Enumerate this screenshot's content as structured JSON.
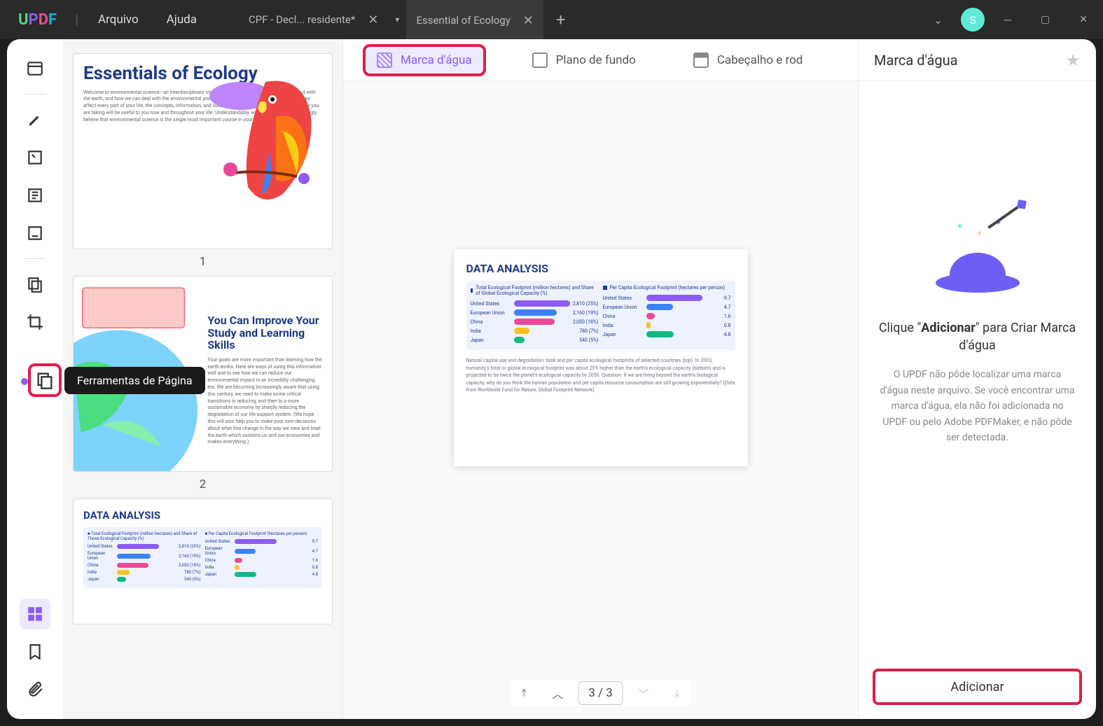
{
  "titlebar": {
    "menus": {
      "file": "Arquivo",
      "help": "Ajuda"
    },
    "tabs": [
      {
        "label": "CPF - Decl... residente*",
        "active": false
      },
      {
        "label": "Essential of Ecology",
        "active": true
      }
    ],
    "avatar_initial": "S"
  },
  "left_rail": {
    "tooltip": "Ferramentas de Página"
  },
  "thumbnails": [
    {
      "num": "1",
      "title": "Essentials of Ecology"
    },
    {
      "num": "2",
      "title": "You Can Improve Your Study and Learning Skills"
    },
    {
      "num": "3",
      "title": "DATA ANALYSIS"
    }
  ],
  "top_tabs": {
    "watermark": "Marca d'água",
    "background": "Plano de fundo",
    "header_footer": "Cabeçalho e rod"
  },
  "pager": {
    "display": "3  /  3"
  },
  "chart_data": {
    "type": "bar",
    "title": "DATA ANALYSIS",
    "left_panel": {
      "header": "Total Ecological Footprint (million hectares) and Share of Global Ecological Capacity (%)",
      "rows": [
        {
          "label": "United States",
          "value_label": "2,810 (25%)",
          "pct": 100,
          "color": "c-purple"
        },
        {
          "label": "European Union",
          "value_label": "2,160 (19%)",
          "pct": 77,
          "color": "c-blue"
        },
        {
          "label": "China",
          "value_label": "2,050 (18%)",
          "pct": 73,
          "color": "c-pink"
        },
        {
          "label": "India",
          "value_label": "780 (7%)",
          "pct": 28,
          "color": "c-yellow"
        },
        {
          "label": "Japan",
          "value_label": "540 (5%)",
          "pct": 19,
          "color": "c-green"
        }
      ]
    },
    "right_panel": {
      "header": "Per Capita Ecological Footprint (hectares per person)",
      "rows": [
        {
          "label": "United States",
          "value_label": "9.7",
          "pct": 100,
          "color": "c-purple"
        },
        {
          "label": "European Union",
          "value_label": "4.7",
          "pct": 48,
          "color": "c-blue"
        },
        {
          "label": "China",
          "value_label": "1.6",
          "pct": 16,
          "color": "c-pink"
        },
        {
          "label": "India",
          "value_label": "0.8",
          "pct": 8,
          "color": "c-yellow"
        },
        {
          "label": "Japan",
          "value_label": "4.8",
          "pct": 49,
          "color": "c-green"
        }
      ]
    },
    "note": "Natural capital use and degradation: total and per capita ecological footprints of selected countries (top). In 2003, humanity's total or global ecological footprint was about 25% higher than the earth's ecological capacity (bottom) and is projected to be twice the planet's ecological capacity by 2050. Question: If we are living beyond the earth's biological capacity, why do you think the human population and per capita resource consumption are still growing exponentially? (Data from Worldwide Fund for Nature, Global Footprint Network)."
  },
  "right_panel": {
    "title": "Marca d'água",
    "prompt_pre": "Clique \"",
    "prompt_bold": "Adicionar",
    "prompt_post": "\" para Criar Marca d'água",
    "description": "O UPDF não pôde localizar uma marca d'água neste arquivo. Se você encontrar uma marca d'água, ela não foi adicionada no UPDF ou pelo Adobe PDFMaker, e não pôde ser detectada.",
    "add_button": "Adicionar"
  }
}
